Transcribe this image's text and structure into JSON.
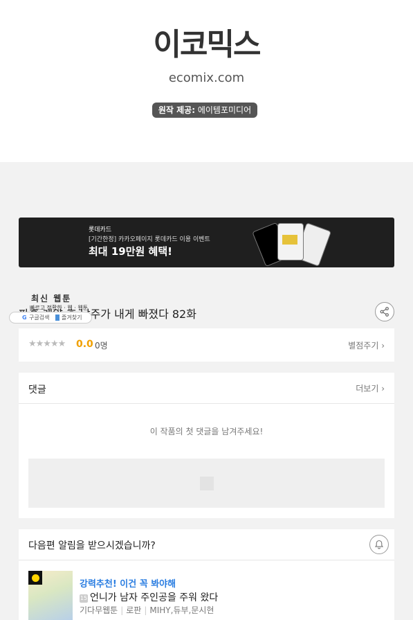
{
  "header": {
    "logo": "이코믹스",
    "domain": "ecomix.com",
    "credit_label": "원작 제공:",
    "credit_value": "에이템포미디어"
  },
  "banner": {
    "brand": "롯데카드",
    "subtitle": "[기간한정] 카카오페이지 롯데카드 이용 이벤트",
    "headline": "최대 19만원 혜택!"
  },
  "overlay": {
    "title": "최신 웹툰",
    "subtitle": "빠르고 정확한 · 웹 · 웹툰",
    "search_label": "구글검색",
    "bookmark_label": "즐겨찾기"
  },
  "episode": {
    "title": "파혼 계약 후 남주가 내게 빠졌다 82화"
  },
  "rating": {
    "stars": "★★★★★",
    "score": "0.0",
    "count": "0명",
    "rate_link": "별점주기 ›"
  },
  "comments": {
    "title": "댓글",
    "more": "더보기 ›",
    "empty_message": "이 작품의 첫 댓글을 남겨주세요!"
  },
  "notify": {
    "question": "다음편 알림을 받으시겠습니까?",
    "recommend_tag": "강력추천! 이건 꼭 봐야해",
    "age_badge": "15",
    "recommend_title": "언니가 남자 주인공을 주워 왔다",
    "meta": [
      "기다무웹툰",
      "로판",
      "MIHY,듀부,문시현"
    ]
  },
  "colors": {
    "score": "#f0a000",
    "recommend_tag": "#2a7de1",
    "banner_bg": "#1f1f1f",
    "page_bg": "#f2f2f2"
  }
}
